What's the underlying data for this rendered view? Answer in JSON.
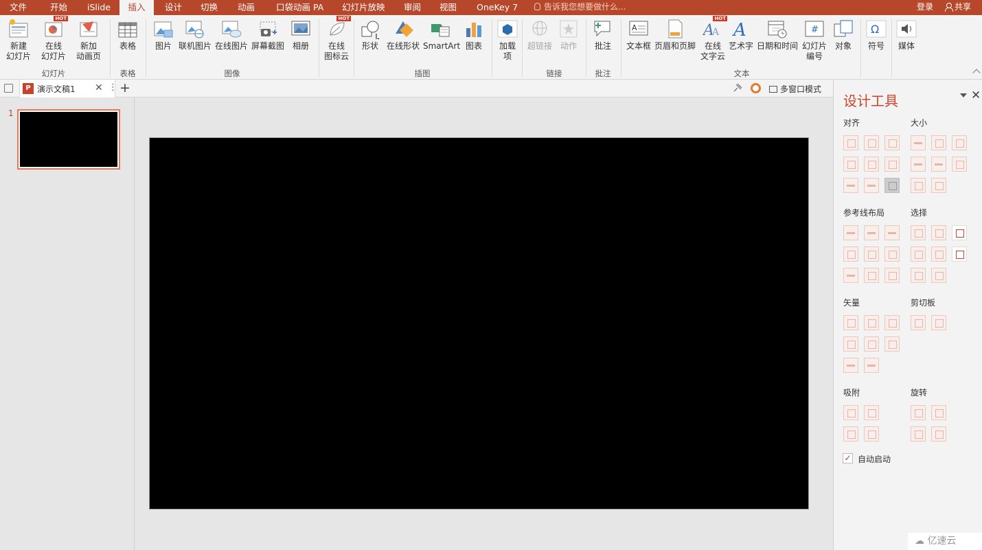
{
  "menubar": {
    "tabs": [
      "文件",
      "开始",
      "iSlide",
      "插入",
      "设计",
      "切换",
      "动画",
      "口袋动画 PA",
      "幻灯片放映",
      "审阅",
      "视图",
      "OneKey 7"
    ],
    "active": "插入",
    "tell_me": "告诉我您想要做什么...",
    "login": "登录",
    "share": "共享",
    "color": "#b7472a"
  },
  "ribbon": {
    "hot_badge": "HOT",
    "buttons": {
      "new_slide": "新建\n幻灯片",
      "online_slide": "在线\n幻灯片",
      "new_anim_page": "新加\n动画页",
      "table": "表格",
      "picture": "图片",
      "online_picture": "联机图片",
      "online_picture2": "在线图片",
      "screenshot": "屏幕截图",
      "album": "相册",
      "icon_cloud": "在线\n图标云",
      "shapes": "形状",
      "online_shapes": "在线形状",
      "smartart": "SmartArt",
      "chart": "图表",
      "addins": "加载\n项",
      "hyperlink": "超链接",
      "action": "动作",
      "comment": "批注",
      "textbox": "文本框",
      "header_footer": "页眉和页脚",
      "text_cloud": "在线\n文字云",
      "wordart": "艺术字",
      "datetime": "日期和时间",
      "slide_number": "幻灯片\n编号",
      "object": "对象",
      "symbol": "符号",
      "media": "媒体"
    },
    "groups": {
      "slides": "幻灯片",
      "tables": "表格",
      "images": "图像",
      "illustrations": "插图",
      "links": "链接",
      "comments": "批注",
      "text": "文本"
    }
  },
  "doc_tab": {
    "title": "演示文稿1",
    "multi_window": "多窗口模式"
  },
  "thumbnails": [
    {
      "number": "1"
    }
  ],
  "panel": {
    "title": "设计工具",
    "sections": {
      "align": "对齐",
      "size": "大小",
      "guide": "参考线布局",
      "select": "选择",
      "vector": "矢量",
      "clipboard": "剪切板",
      "snap": "吸附",
      "rotate": "旋转"
    },
    "auto_start_label": "自动启动",
    "auto_start_checked": true
  },
  "watermark": "亿速云"
}
